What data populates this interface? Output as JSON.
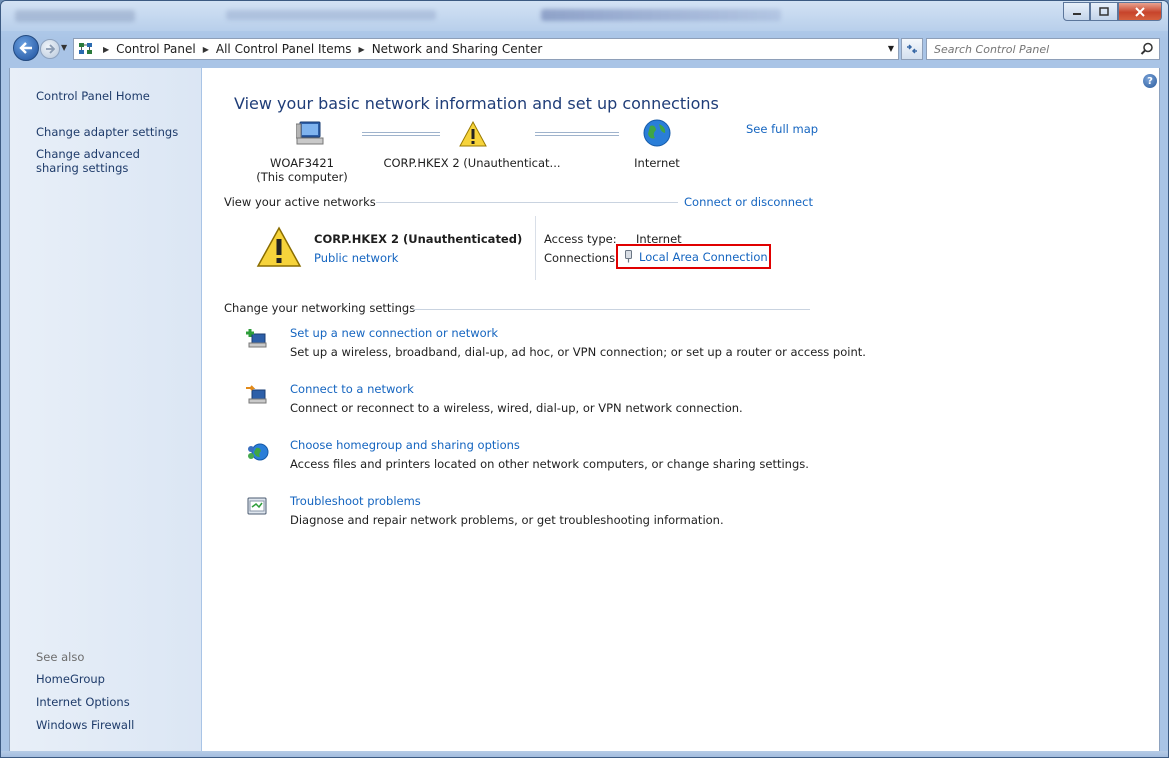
{
  "window": {
    "minimize_icon": "minimize-icon",
    "maximize_icon": "maximize-icon",
    "close_icon": "close-icon"
  },
  "address": {
    "crumbs": [
      "Control Panel",
      "All Control Panel Items",
      "Network and Sharing Center"
    ],
    "search_placeholder": "Search Control Panel"
  },
  "sidebar": {
    "home": "Control Panel Home",
    "links": [
      "Change adapter settings",
      "Change advanced sharing settings"
    ],
    "see_also_label": "See also",
    "see_also": [
      "HomeGroup",
      "Internet Options",
      "Windows Firewall"
    ]
  },
  "main": {
    "heading": "View your basic network information and set up connections",
    "see_full_map": "See full map",
    "map": {
      "computer_name": "WOAF3421",
      "computer_sub": "(This computer)",
      "network_name": "CORP.HKEX  2 (Unauthenticat...",
      "internet": "Internet"
    },
    "active_networks": {
      "title": "View your active networks",
      "connect_link": "Connect or disconnect",
      "name": "CORP.HKEX  2 (Unauthenticated)",
      "type": "Public network",
      "access_label": "Access type:",
      "access_value": "Internet",
      "connections_label": "Connections:",
      "connection_link": "Local Area Connection"
    },
    "settings": {
      "title": "Change your networking settings",
      "tasks": [
        {
          "title": "Set up a new connection or network",
          "desc": "Set up a wireless, broadband, dial-up, ad hoc, or VPN connection; or set up a router or access point."
        },
        {
          "title": "Connect to a network",
          "desc": "Connect or reconnect to a wireless, wired, dial-up, or VPN network connection."
        },
        {
          "title": "Choose homegroup and sharing options",
          "desc": "Access files and printers located on other network computers, or change sharing settings."
        },
        {
          "title": "Troubleshoot problems",
          "desc": "Diagnose and repair network problems, or get troubleshooting information."
        }
      ]
    }
  }
}
